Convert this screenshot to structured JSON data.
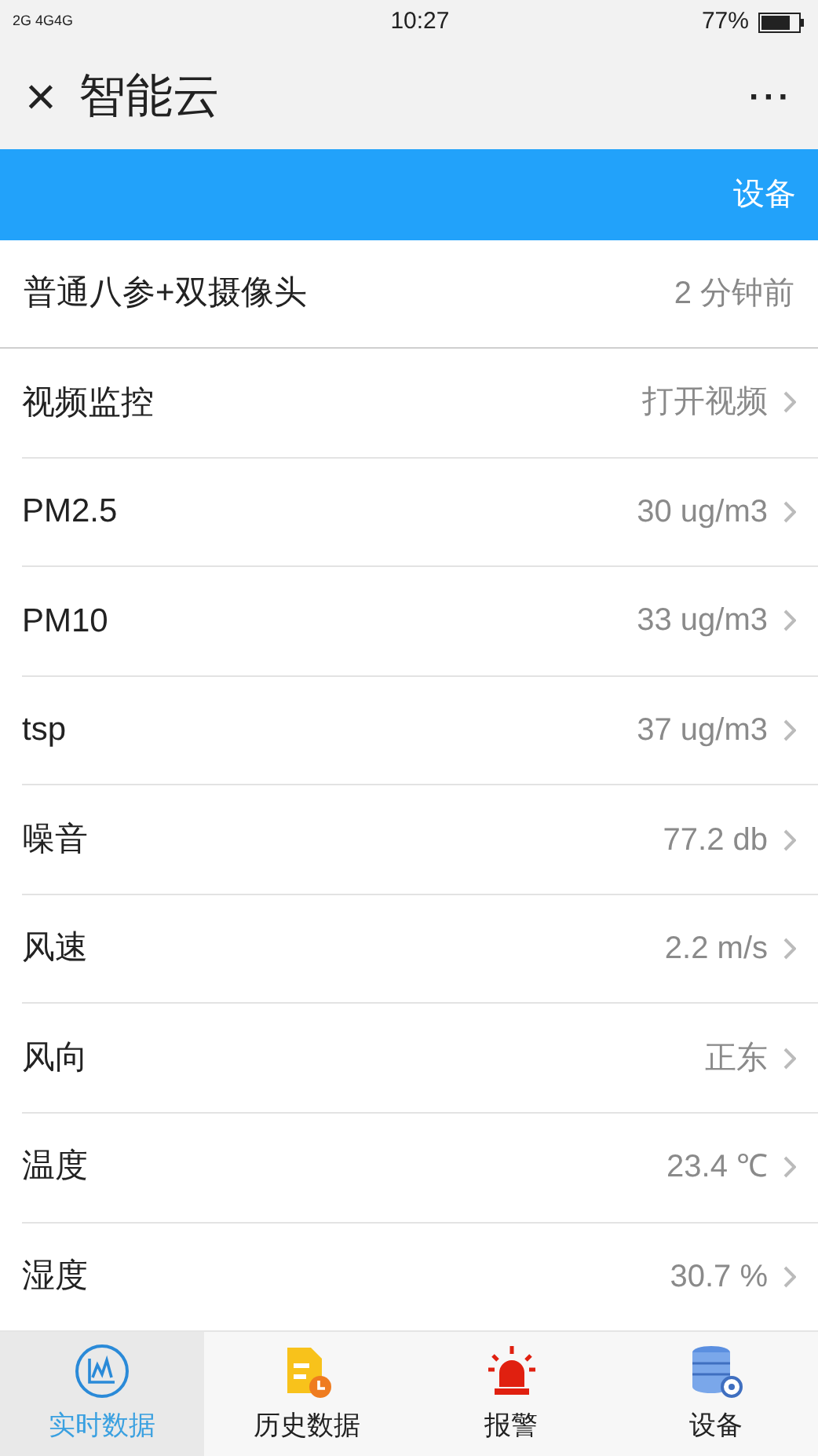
{
  "status_bar": {
    "network": "2G 4G4G",
    "time": "10:27",
    "battery": "77%"
  },
  "window": {
    "close": "×",
    "title": "智能云",
    "more": "···"
  },
  "blue_bar": {
    "label": "设备"
  },
  "device": {
    "name": "普通八参+双摄像头",
    "updated": "2 分钟前"
  },
  "readings": [
    {
      "label": "视频监控",
      "value": "打开视频"
    },
    {
      "label": "PM2.5",
      "value": "30 ug/m3"
    },
    {
      "label": "PM10",
      "value": "33 ug/m3"
    },
    {
      "label": "tsp",
      "value": "37 ug/m3"
    },
    {
      "label": "噪音",
      "value": "77.2 db"
    },
    {
      "label": "风速",
      "value": "2.2 m/s"
    },
    {
      "label": "风向",
      "value": "正东"
    },
    {
      "label": "温度",
      "value": "23.4 ℃"
    },
    {
      "label": "湿度",
      "value": "30.7 %"
    }
  ],
  "tabs": [
    {
      "label": "实时数据",
      "kind": "chart",
      "selected": true
    },
    {
      "label": "历史数据",
      "kind": "document",
      "selected": false
    },
    {
      "label": "报警",
      "kind": "alarm",
      "selected": false
    },
    {
      "label": "设备",
      "kind": "database",
      "selected": false
    }
  ]
}
